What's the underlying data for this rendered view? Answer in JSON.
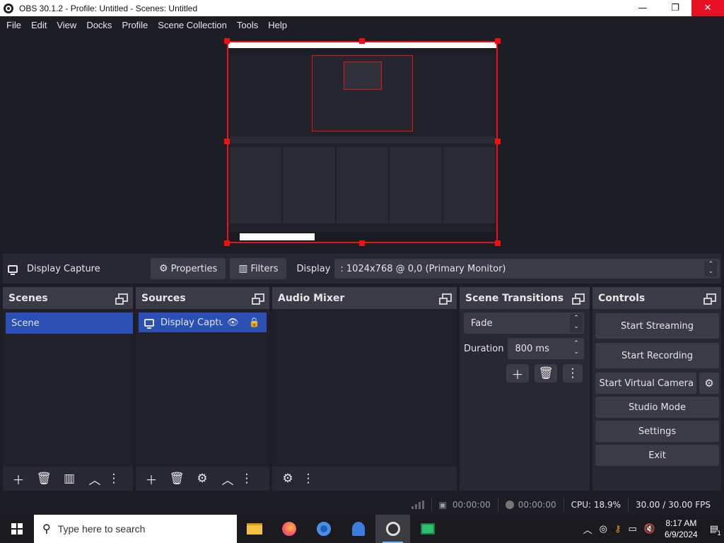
{
  "window": {
    "title": "OBS 30.1.2 - Profile: Untitled - Scenes: Untitled",
    "minimize": "—",
    "restore": "❐",
    "close": "✕"
  },
  "menu": [
    "File",
    "Edit",
    "View",
    "Docks",
    "Profile",
    "Scene Collection",
    "Tools",
    "Help"
  ],
  "source_toolbar": {
    "source_name": "Display Capture",
    "properties_label": "Properties",
    "filters_label": "Filters",
    "display_label": "Display",
    "display_value": ": 1024x768 @ 0,0 (Primary Monitor)"
  },
  "docks": {
    "scenes": {
      "title": "Scenes",
      "items": [
        "Scene"
      ]
    },
    "sources": {
      "title": "Sources",
      "items": [
        "Display Captur"
      ]
    },
    "audio_mixer": {
      "title": "Audio Mixer"
    },
    "transitions": {
      "title": "Scene Transitions",
      "transition": "Fade",
      "duration_label": "Duration",
      "duration_value": "800 ms"
    },
    "controls": {
      "title": "Controls",
      "start_streaming": "Start Streaming",
      "start_recording": "Start Recording",
      "start_virtual_camera": "Start Virtual Camera",
      "studio_mode": "Studio Mode",
      "settings": "Settings",
      "exit": "Exit"
    }
  },
  "status": {
    "stream_time": "00:00:00",
    "record_time": "00:00:00",
    "cpu": "CPU: 18.9%",
    "fps": "30.00 / 30.00 FPS"
  },
  "taskbar": {
    "search_placeholder": "Type here to search",
    "time": "8:17 AM",
    "date": "6/9/2024",
    "notification_count": "1"
  },
  "colors": {
    "selection": "#2a4fb5",
    "preview_border": "#ee1111",
    "close_button": "#e81123"
  }
}
